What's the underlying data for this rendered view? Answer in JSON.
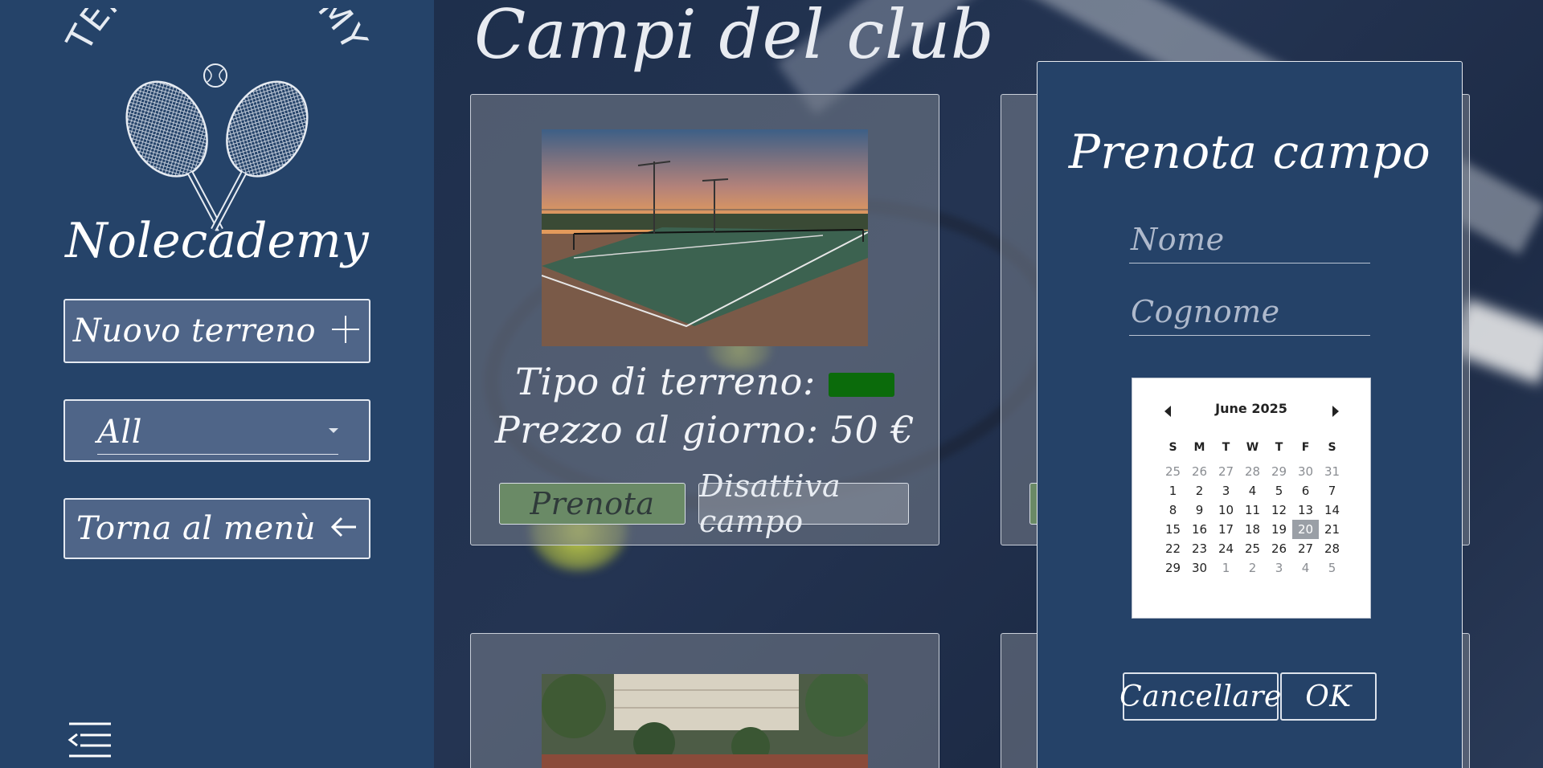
{
  "sidebar": {
    "logo_top": "TENNIS ACADEMY",
    "logo_bottom": "Nolecademy",
    "new_field_label": "Nuovo terreno",
    "filter_value": "All",
    "back_label": "Torna al menù"
  },
  "main": {
    "title": "Campi del club",
    "cards": [
      {
        "type_label": "Tipo di terreno:",
        "type_color": "#0b6b0b",
        "price_label": "Prezzo al giorno: 50 €",
        "book_label": "Prenota",
        "deactivate_label": "Disattiva campo"
      }
    ]
  },
  "booking": {
    "title": "Prenota campo",
    "name_placeholder": "Nome",
    "surname_placeholder": "Cognome",
    "calendar": {
      "month_label": "June 2025",
      "weekdays": [
        "S",
        "M",
        "T",
        "W",
        "T",
        "F",
        "S"
      ],
      "weeks": [
        [
          "25",
          "26",
          "27",
          "28",
          "29",
          "30",
          "31"
        ],
        [
          "1",
          "2",
          "3",
          "4",
          "5",
          "6",
          "7"
        ],
        [
          "8",
          "9",
          "10",
          "11",
          "12",
          "13",
          "14"
        ],
        [
          "15",
          "16",
          "17",
          "18",
          "19",
          "20",
          "21"
        ],
        [
          "22",
          "23",
          "24",
          "25",
          "26",
          "27",
          "28"
        ],
        [
          "29",
          "30",
          "1",
          "2",
          "3",
          "4",
          "5"
        ]
      ],
      "selected_day": "20"
    },
    "cancel_label": "Cancellare",
    "ok_label": "OK"
  }
}
